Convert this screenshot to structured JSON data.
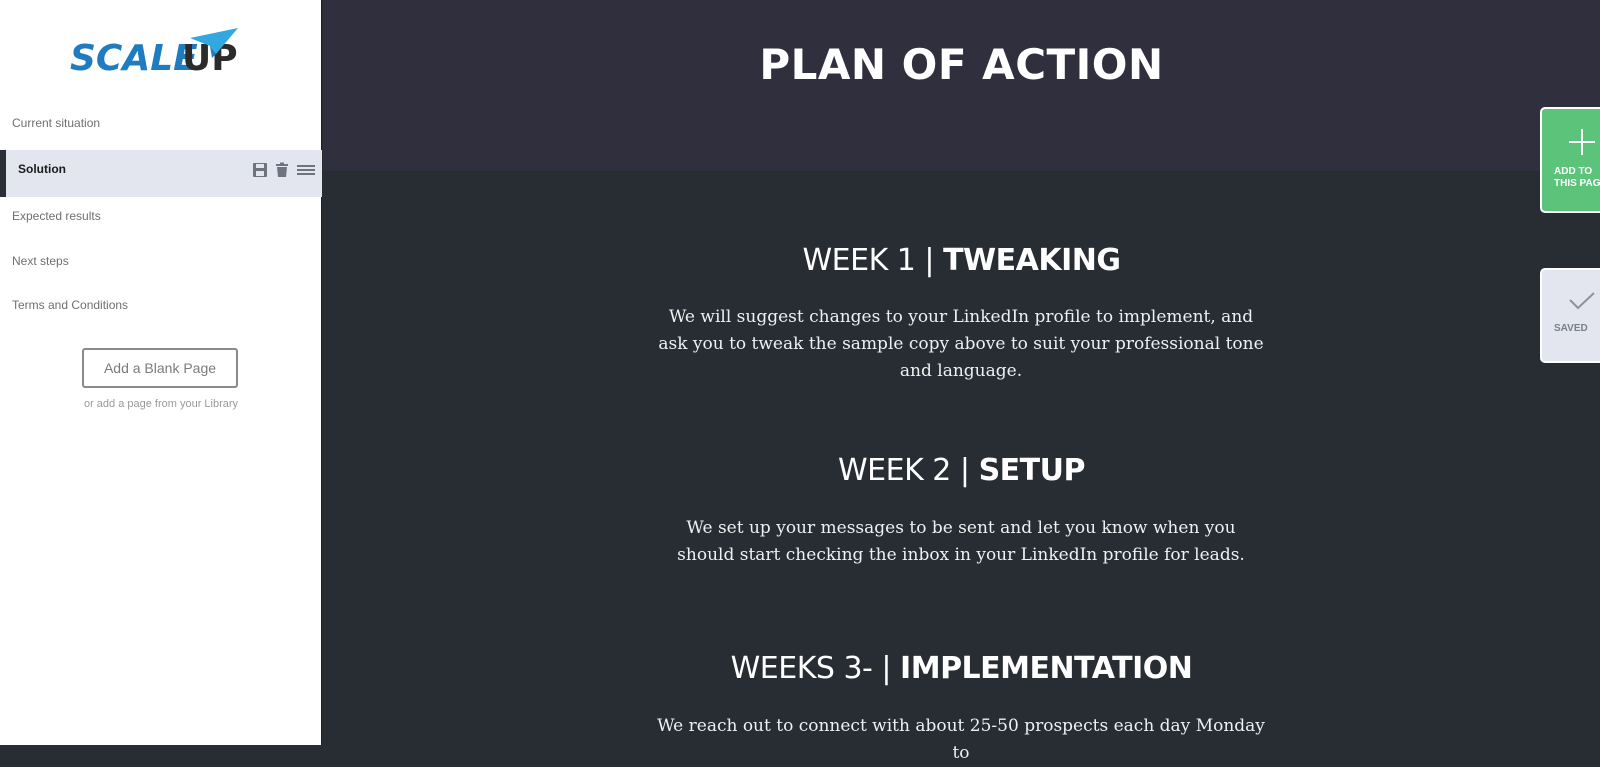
{
  "logo": {
    "text_part1": "SCALE",
    "text_part2": "UP"
  },
  "sidebar": {
    "items": [
      {
        "label": "Current situation"
      },
      {
        "label": "Solution"
      },
      {
        "label": "Expected results"
      },
      {
        "label": "Next steps"
      },
      {
        "label": "Terms and Conditions"
      }
    ],
    "add_blank_label": "Add a Blank Page",
    "library_note": "or add a page from your Library"
  },
  "page": {
    "title": "PLAN OF ACTION",
    "weeks": [
      {
        "prefix": "WEEK 1 | ",
        "title": "TWEAKING",
        "body": "We will suggest changes to your LinkedIn profile to implement, and ask you to tweak the sample copy above to suit your professional tone and language."
      },
      {
        "prefix": "WEEK 2 | ",
        "title": "SETUP",
        "body": "We set up your messages to be sent and let you know when you should start checking the inbox in your LinkedIn profile for leads."
      },
      {
        "prefix": "WEEKS 3- | ",
        "title": "IMPLEMENTATION",
        "body": "We reach out to connect with about 25-50 prospects each day Monday to"
      }
    ]
  },
  "widgets": {
    "add_to_page_label": "ADD TO THIS PAGE",
    "saved_label": "SAVED"
  },
  "colors": {
    "header_band": "#302f3d",
    "main_bg": "#272d33",
    "accent_green": "#5bc37a",
    "logo_blue": "#1f7cc0",
    "logo_dark": "#2b2b2b"
  }
}
